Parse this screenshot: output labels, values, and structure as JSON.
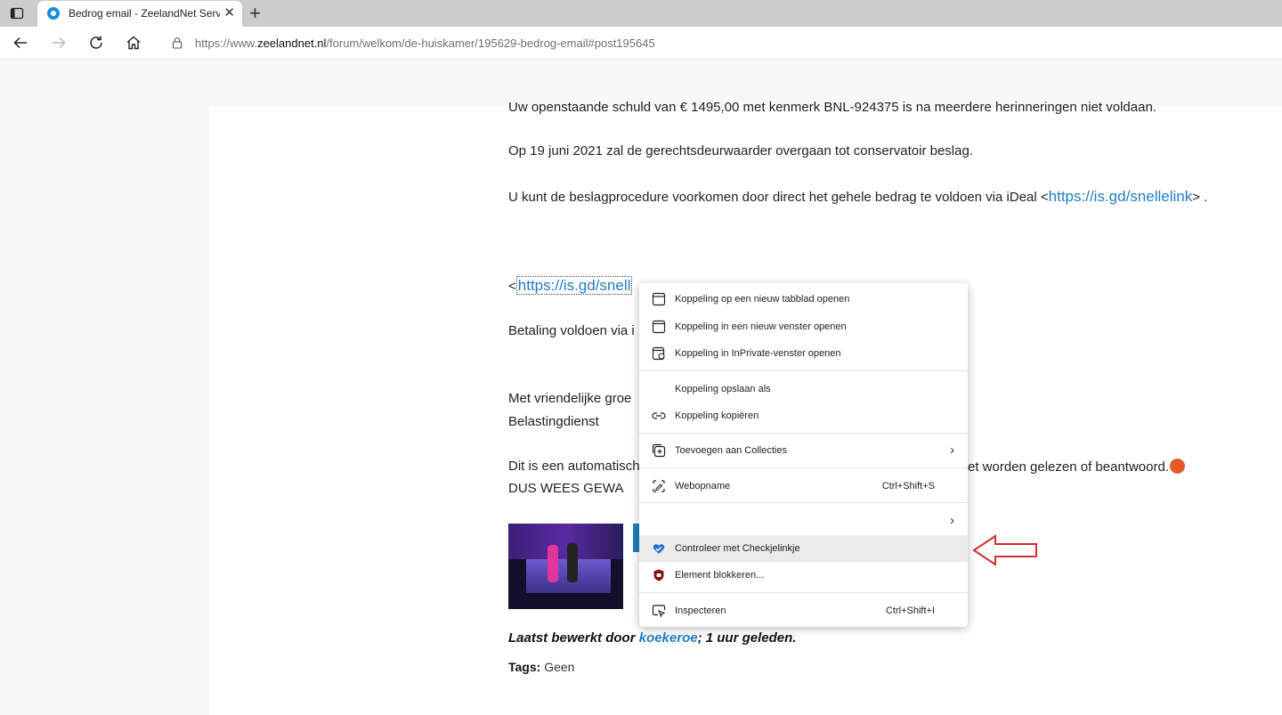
{
  "browser": {
    "tab_title": "Bedrog email - ZeelandNet Servi",
    "tab_close": "✕",
    "new_tab": "+",
    "url_prefix": "https://www.",
    "url_host": "zeelandnet.nl",
    "url_path": "/forum/welkom/de-huiskamer/195629-bedrog-email#post195645"
  },
  "post": {
    "cut_line": "Uw openstaande schuld van € 1495,00 met kenmerk BNL-924375 is na meerdere herinneringen niet voldaan.",
    "line_beslag": "Op 19 juni 2021 zal de gerechtsdeurwaarder overgaan tot conservatoir beslag.",
    "line_ideal_pre": "U kunt de beslagprocedure voorkomen door direct het gehele bedrag te voldoen via iDeal <",
    "link_url": "https://is.gd/snellelink",
    "line_ideal_post": "> .",
    "link_open": "<",
    "link_partial": "https://is.gd/snell",
    "betaling": "Betaling voldoen via i",
    "groet": "Met vriendelijke groe",
    "afzender": "Belastingdienst",
    "auto_pre": "Dit is een automatisch",
    "auto_post": "et worden gelezen of beantwoord.",
    "warning": "DUS WEES GEWA",
    "edited_prefix": "Laatst bewerkt door ",
    "edited_user": "koekeroe",
    "edited_suffix": "; 1 uur geleden.",
    "tags_label": "Tags:",
    "tags_value": " Geen"
  },
  "context_menu": {
    "items": [
      {
        "label": "Koppeling op een nieuw tabblad openen",
        "icon": "new-tab-icon"
      },
      {
        "label": "Koppeling in een nieuw venster openen",
        "icon": "new-window-icon"
      },
      {
        "label": "Koppeling in InPrivate-venster openen",
        "icon": "inprivate-icon"
      },
      {
        "label": "Koppeling opslaan als",
        "icon": ""
      },
      {
        "label": "Koppeling kopiëren",
        "icon": "link-icon"
      },
      {
        "label": "Toevoegen aan Collecties",
        "icon": "collections-icon",
        "chevron": "›"
      },
      {
        "label": "Webopname",
        "icon": "web-capture-icon",
        "shortcut": "Ctrl+Shift+S"
      },
      {
        "label": "",
        "icon": "",
        "chevron": "›"
      },
      {
        "label": "Controleer met Checkjelinkje",
        "icon": "checkjelinkje-heart-icon"
      },
      {
        "label": "Element blokkeren...",
        "icon": "ublock-shield-icon"
      },
      {
        "label": "Inspecteren",
        "icon": "inspect-icon",
        "shortcut": "Ctrl+Shift+I"
      }
    ]
  },
  "colors": {
    "link": "#1e7ec2",
    "arrow": "#d32f2f",
    "menu_highlight": "#ebebeb"
  }
}
